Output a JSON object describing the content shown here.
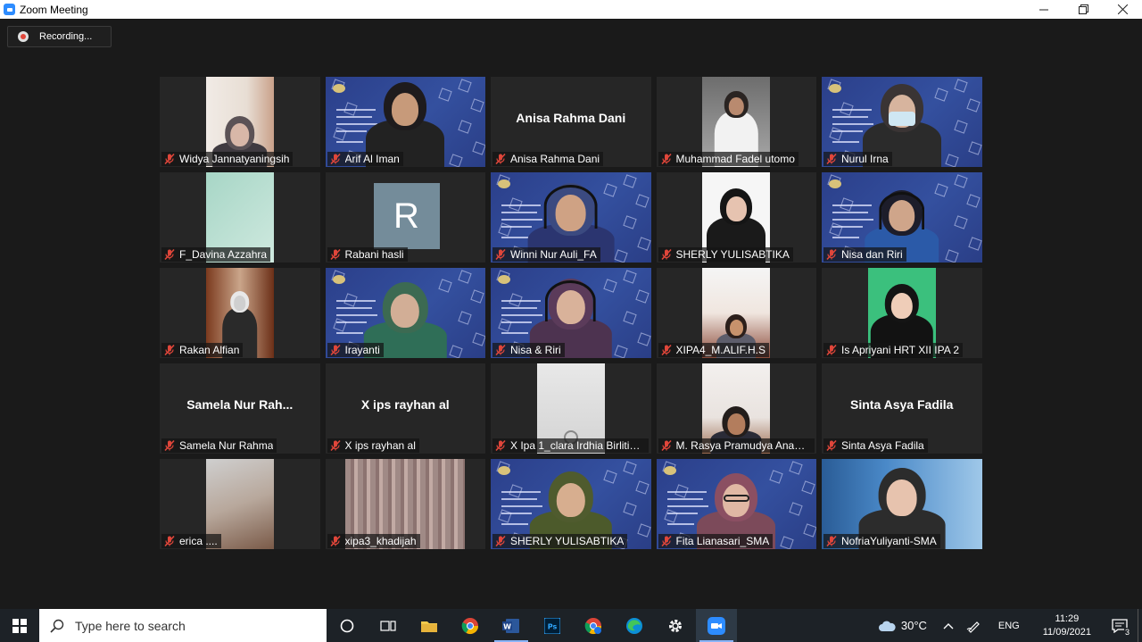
{
  "window": {
    "title": "Zoom Meeting"
  },
  "recording": {
    "label": "Recording..."
  },
  "participants": [
    {
      "name": "Widya Jannatyaningsih"
    },
    {
      "name": "Arif Al Iman"
    },
    {
      "name": "Anisa Rahma Dani",
      "display_name": "Anisa Rahma Dani"
    },
    {
      "name": "Muhammad Fadel utomo"
    },
    {
      "name": "Nurul Irna"
    },
    {
      "name": "F_Davina Azzahra"
    },
    {
      "name": "Rabani hasli",
      "avatar_letter": "R"
    },
    {
      "name": "Winni Nur Auli_FA"
    },
    {
      "name": "SHERLY YULISABTIKA"
    },
    {
      "name": "Nisa dan Riri"
    },
    {
      "name": "Rakan Alfian"
    },
    {
      "name": "Irayanti"
    },
    {
      "name": "Nisa & Riri"
    },
    {
      "name": "XIPA4_M.ALIF.H.S"
    },
    {
      "name": "Is Apriyani HRT XII IPA 2"
    },
    {
      "name": "Samela Nur Rahma",
      "display_name": "Samela Nur Rah..."
    },
    {
      "name": "X ips rayhan al",
      "display_name": "X ips rayhan al"
    },
    {
      "name": "X Ipa 1_clara Irdhia Birlitika..."
    },
    {
      "name": "M. Rasya Pramudya Anand..."
    },
    {
      "name": "Sinta Asya Fadila",
      "display_name": "Sinta Asya Fadila"
    },
    {
      "name": "erica ...."
    },
    {
      "name": "xipa3_khadijah"
    },
    {
      "name": "SHERLY YULISABTIKA"
    },
    {
      "name": "Fita Lianasari_SMA"
    },
    {
      "name": "NofriaYuliyanti-SMA"
    }
  ],
  "taskbar": {
    "search_placeholder": "Type here to search",
    "temperature": "30°C",
    "language": "ENG",
    "time": "11:29",
    "date": "11/09/2021",
    "notification_count": "3"
  },
  "colors": {
    "active_speaker": "#f5f06a",
    "muted_mic": "#e0463a",
    "zoom_blue": "#2d8cff"
  }
}
